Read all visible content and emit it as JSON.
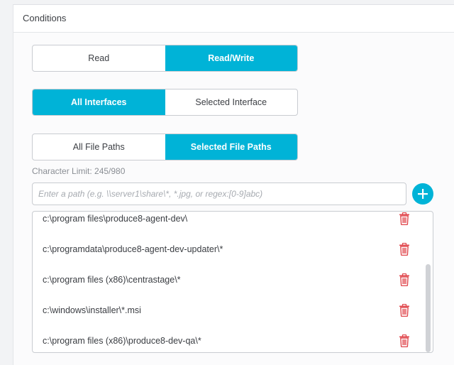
{
  "panel": {
    "title": "Conditions"
  },
  "access_toggle": {
    "options": [
      "Read",
      "Read/Write"
    ],
    "selected": "Read/Write"
  },
  "interface_toggle": {
    "options": [
      "All Interfaces",
      "Selected Interface"
    ],
    "selected": "All Interfaces"
  },
  "filepath_toggle": {
    "options": [
      "All File Paths",
      "Selected File Paths"
    ],
    "selected": "Selected File Paths"
  },
  "char_limit": "Character Limit: 245/980",
  "path_input": {
    "placeholder": "Enter a path (e.g. \\\\server1\\share\\*, *.jpg, or regex:[0-9]abc)",
    "value": ""
  },
  "paths": [
    "c:\\program files\\produce8-agent-dev\\",
    "c:\\programdata\\produce8-agent-dev-updater\\*",
    "c:\\program files (x86)\\centrastage\\*",
    "c:\\windows\\installer\\*.msi",
    "c:\\program files (x86)\\produce8-dev-qa\\*"
  ],
  "colors": {
    "accent": "#00b3d7",
    "delete": "#e0474c"
  },
  "icons": {
    "add": "plus-icon",
    "delete": "trash-icon"
  }
}
